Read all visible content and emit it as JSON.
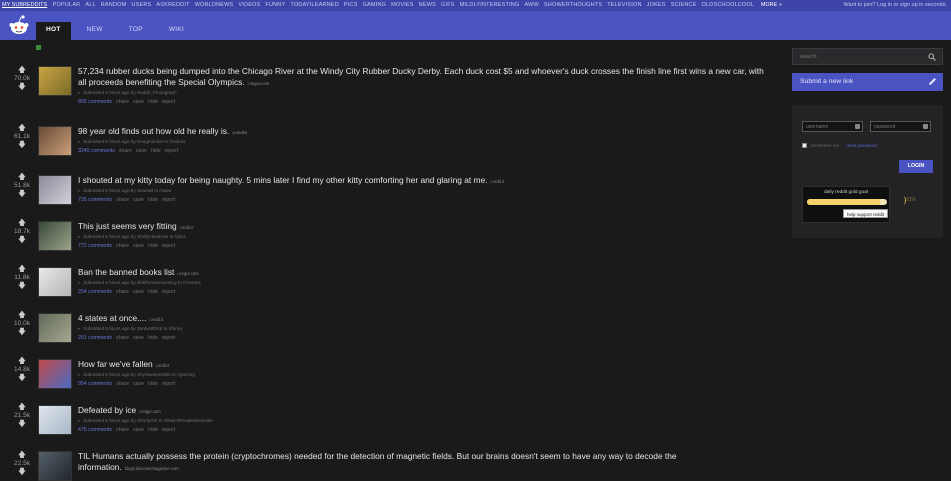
{
  "subreddit_bar": {
    "my_subreddits": "MY SUBREDDITS",
    "items": [
      "POPULAR",
      "ALL",
      "RANDOM",
      "USERS",
      "ASKREDDIT",
      "WORLDNEWS",
      "VIDEOS",
      "FUNNY",
      "TODAYILEARNED",
      "PICS",
      "GAMING",
      "MOVIES",
      "NEWS",
      "GIFS",
      "MILDLYINTERESTING",
      "AWW",
      "SHOWERTHOUGHTS",
      "TELEVISION",
      "JOKES",
      "SCIENCE",
      "OLDSCHOOLCOOL"
    ],
    "more": "MORE »",
    "login_prompt": "Want to join? Log in or sign up in seconds."
  },
  "header": {
    "tabs": [
      {
        "label": "HOT",
        "active": true
      },
      {
        "label": "NEW",
        "active": false
      },
      {
        "label": "TOP",
        "active": false
      },
      {
        "label": "WIKI",
        "active": false
      }
    ],
    "accent_color": "#4a53c2"
  },
  "posts": [
    {
      "score": "70.0k",
      "title": "57,234 rubber ducks being dumped into the Chicago River at the Windy City Rubber Ducky Derby. Each duck cost $5 and whoever's duck crosses the finish line first wins a new car, with all proceeds benefiting the Special Olympics.",
      "domain": "i.imgur.com",
      "tagline": "Submitted 4 hours ago by Reddit_Photograph",
      "comments": "805 comments",
      "actions": [
        "share",
        "save",
        "hide",
        "report"
      ]
    },
    {
      "score": "61.1k",
      "title": "98 year old finds out how old he really is.",
      "domain": "youtube",
      "tagline": "Submitted 5 hours ago by Dougmanlod to r/videos",
      "comments": "3240 comments",
      "actions": [
        "share",
        "save",
        "hide",
        "report"
      ]
    },
    {
      "score": "51.8k",
      "title": "I shouted at my kitty today for being naughty. 5 mins later I find my other kitty comforting her and glaring at me.",
      "domain": "i.redd.it",
      "tagline": "Submitted 5 hours ago by SeaOwl to r/aww",
      "comments": "725 comments",
      "actions": [
        "share",
        "save",
        "hide",
        "report"
      ]
    },
    {
      "score": "18.7k",
      "title": "This just seems very fitting",
      "domain": "i.redd.it",
      "tagline": "Submitted 5 hours ago by ShellyHardman to r/pics",
      "comments": "772 comments",
      "actions": [
        "share",
        "save",
        "hide",
        "report"
      ]
    },
    {
      "score": "11.8k",
      "title": "Ban the banned books list",
      "domain": "i.imgur.com",
      "tagline": "Submitted 4 hours ago by dickfromaccounting to r/memes",
      "comments": "254 comments",
      "actions": [
        "share",
        "save",
        "hide",
        "report"
      ]
    },
    {
      "score": "10.0k",
      "title": "4 states at once....",
      "domain": "i.redd.it",
      "tagline": "Submitted 5 hours ago by Zerdwolf349 to r/funny",
      "comments": "291 comments",
      "actions": [
        "share",
        "save",
        "hide",
        "report"
      ]
    },
    {
      "score": "14.8k",
      "title": "How far we've fallen",
      "domain": "i.redd.it",
      "tagline": "Submitted 5 hours ago by ShySweeper550 to r/gaming",
      "comments": "954 comments",
      "actions": [
        "share",
        "save",
        "hide",
        "report"
      ]
    },
    {
      "score": "21.5k",
      "title": "Defeated by ice",
      "domain": "i.imgur.com",
      "tagline": "Submitted 5 hours ago by ShortyGirl to r/WatchPeopleDieInside",
      "comments": "475 comments",
      "actions": [
        "share",
        "save",
        "hide",
        "report"
      ]
    },
    {
      "score": "22.5k",
      "title": "TIL Humans actually possess the protein (cryptochromes) needed for the detection of magnetic fields. But our brains doesn't seem to have any way to decode the information.",
      "domain": "blogs.discovermagazine.com",
      "tagline": "",
      "comments": "",
      "actions": []
    }
  ],
  "sidebar": {
    "search_placeholder": "search",
    "submit_link": "Submit a new link",
    "username_placeholder": "username",
    "password_placeholder": "password",
    "remember_me": "remember me",
    "reset_password": "reset password",
    "login": "LOGIN",
    "gold_label": "daily reddit gold goal",
    "gold_percent": "91%",
    "gold_progress": 0.91,
    "help_support": "help support reddit"
  }
}
